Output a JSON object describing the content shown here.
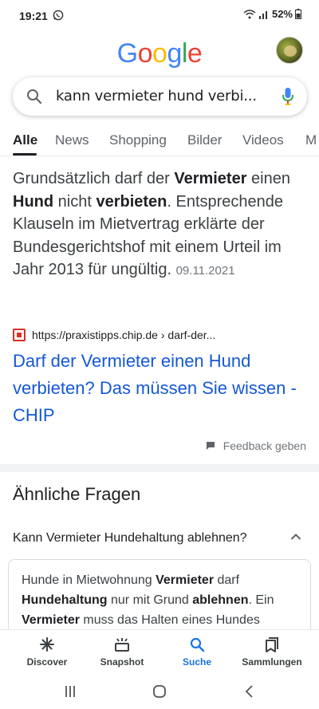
{
  "status_bar": {
    "time": "19:21",
    "battery": "52%"
  },
  "header": {
    "logo_letters": [
      {
        "ch": "G",
        "color": "#4285F4"
      },
      {
        "ch": "o",
        "color": "#EA4335"
      },
      {
        "ch": "o",
        "color": "#FBBC05"
      },
      {
        "ch": "g",
        "color": "#4285F4"
      },
      {
        "ch": "l",
        "color": "#34A853"
      },
      {
        "ch": "e",
        "color": "#EA4335"
      }
    ]
  },
  "search": {
    "query": "kann vermieter hund verbi..."
  },
  "tabs": [
    {
      "label": "Alle",
      "active": true
    },
    {
      "label": "News"
    },
    {
      "label": "Shopping"
    },
    {
      "label": "Bilder"
    },
    {
      "label": "Videos"
    },
    {
      "label": "M"
    }
  ],
  "featured_snippet": {
    "parts": [
      {
        "t": "Grundsätzlich darf der ",
        "b": false
      },
      {
        "t": "Vermieter",
        "b": true
      },
      {
        "t": " einen ",
        "b": false
      },
      {
        "t": "Hund",
        "b": true
      },
      {
        "t": " nicht ",
        "b": false
      },
      {
        "t": "verbieten",
        "b": true
      },
      {
        "t": ". Entsprechende Klauseln im Mietvertrag erklärte der Bundesgerichtshof mit einem Urteil im Jahr 2013 für ungültig.",
        "b": false
      }
    ],
    "date": "09.11.2021",
    "source_url": "https://praxistipps.chip.de › darf-der...",
    "result_title": "Darf der Vermieter einen Hund verbieten? Das müssen Sie wissen - CHIP",
    "feedback_label": "Feedback geben"
  },
  "related_questions": {
    "title": "Ähnliche Fragen",
    "question": "Kann Vermieter Hundehaltung ablehnen?",
    "answer_parts": [
      {
        "t": "Hunde in Mietwohnung ",
        "b": false
      },
      {
        "t": "Vermieter",
        "b": true
      },
      {
        "t": " darf ",
        "b": false
      },
      {
        "t": "Hundehaltung",
        "b": true
      },
      {
        "t": " nur mit Grund ",
        "b": false
      },
      {
        "t": "ablehnen",
        "b": true
      },
      {
        "t": ". Ein ",
        "b": false
      },
      {
        "t": "Vermieter",
        "b": true
      },
      {
        "t": " muss das Halten eines Hundes",
        "b": false
      }
    ]
  },
  "bottom_nav": [
    {
      "label": "Discover",
      "icon": "asterisk-icon"
    },
    {
      "label": "Snapshot",
      "icon": "snapshot-icon"
    },
    {
      "label": "Suche",
      "icon": "search-icon",
      "active": true
    },
    {
      "label": "Sammlungen",
      "icon": "collections-icon"
    }
  ],
  "colors": {
    "link": "#1558d6",
    "accent": "#1a73e8",
    "text": "#202124",
    "muted": "#70757a"
  }
}
